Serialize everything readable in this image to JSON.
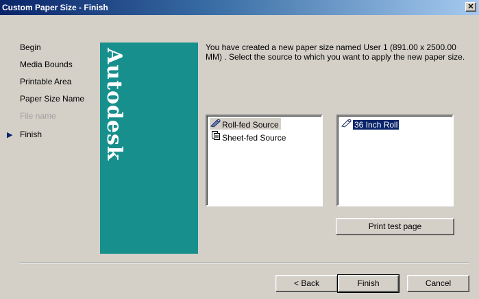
{
  "window": {
    "title": "Custom Paper Size - Finish",
    "close_glyph": "✕"
  },
  "nav": {
    "items": [
      {
        "label": "Begin",
        "state": "normal"
      },
      {
        "label": "Media Bounds",
        "state": "normal"
      },
      {
        "label": "Printable Area",
        "state": "normal"
      },
      {
        "label": "Paper Size Name",
        "state": "normal"
      },
      {
        "label": "File name",
        "state": "disabled"
      },
      {
        "label": "Finish",
        "state": "current"
      }
    ],
    "current_marker": "▶"
  },
  "brand": {
    "text": "Autodesk",
    "color": "#178f8c"
  },
  "description": "You have created a new paper size named User 1 (891.00 x 2500.00 MM) . Select the source to which you want to apply the new paper size.",
  "source_list": {
    "items": [
      {
        "label": "Roll-fed Source",
        "icon": "roll-icon",
        "selected": true
      },
      {
        "label": "Sheet-fed Source",
        "icon": "sheet-icon",
        "selected": false
      }
    ]
  },
  "roll_list": {
    "items": [
      {
        "label": "36 Inch Roll",
        "icon": "roll-icon",
        "selected": true
      }
    ]
  },
  "buttons": {
    "print_test": "Print test page",
    "back": "< Back",
    "finish": "Finish",
    "cancel": "Cancel"
  }
}
